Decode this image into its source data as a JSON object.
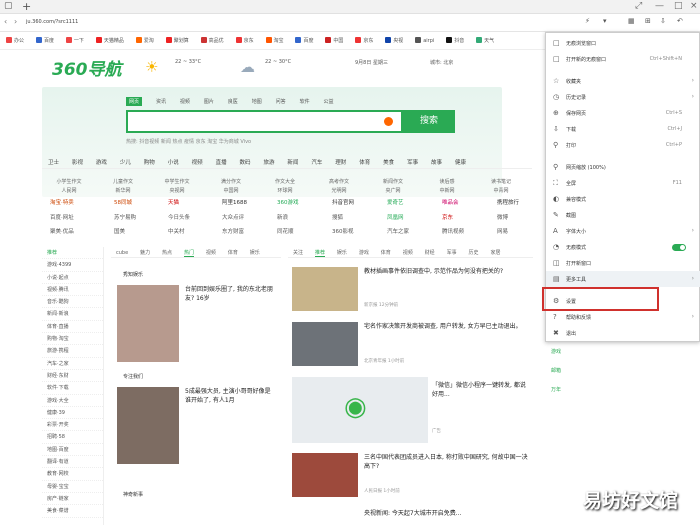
{
  "browser": {
    "url": "ju.360.com/?src1111",
    "bookmarks": [
      "办公",
      "百度",
      "一下",
      "天猫精品",
      "爱淘",
      "聚划算",
      "高品优",
      "京东",
      "淘宝",
      "百度",
      "中国",
      "京东",
      "央视",
      "airpi",
      "抖音",
      "天气",
      "豆瓣"
    ]
  },
  "page": {
    "logo": "360导航",
    "weather": [
      "22 ~ 33°C",
      "22 ~ 30°C",
      "9月8日 星期三",
      "城市: 北京"
    ],
    "search_tabs": [
      "网页",
      "资讯",
      "视频",
      "图片",
      "良医",
      "地图",
      "问答",
      "软件",
      "公益"
    ],
    "search_button": "搜索",
    "hot_words": "热搜: 抖音视频  新闻  热点  疫情  京东  淘宝  华为商城  Vivo",
    "nav": [
      "卫士",
      "影视",
      "游戏",
      "少儿",
      "购物",
      "小说",
      "视频",
      "直播",
      "数码",
      "旅游",
      "新闻",
      "汽车",
      "理财",
      "体育",
      "美食",
      "军事",
      "故事",
      "健康",
      "音乐"
    ],
    "link_row1": [
      "小学生作文",
      "儿童作文",
      "中学生作文",
      "满分作文",
      "作文大全",
      "高考作文",
      "新闻作文",
      "读后感",
      "读书笔记"
    ],
    "link_row2": [
      "人民网",
      "新华网",
      "央视网",
      "中国网",
      "环球网",
      "光明网",
      "央广网",
      "中新网",
      "中青网"
    ],
    "sites": [
      [
        "淘宝·特卖",
        "58同城",
        "天猫",
        "阿里1688",
        "360游戏",
        "抖音官网",
        "爱奇艺",
        "唯品会",
        "携程旅行"
      ],
      [
        "百度·网址",
        "苏宁易购",
        "今日头条",
        "大众点评",
        "新浪",
        "搜狐",
        "凤凰网",
        "京东",
        "微博"
      ],
      [
        "聚美·优品",
        "国美",
        "中关村",
        "东方财富",
        "同花顺",
        "360影视",
        "汽车之家",
        "腾讯视频",
        "网易"
      ]
    ],
    "left_list": [
      "推荐",
      "游戏·4399",
      "小说·起点",
      "视频·腾讯",
      "音乐·酷狗",
      "新闻·新浪",
      "体育·直播",
      "购物·淘宝",
      "旅游·携程",
      "汽车·之家",
      "财经·东财",
      "软件·下载",
      "游戏·大全",
      "健康·39",
      "彩票·开奖",
      "招聘·58",
      "地图·百度",
      "翻译·有道",
      "教育·网校",
      "母婴·宝宝",
      "房产·链家",
      "美食·菜谱"
    ],
    "middle_tabs": [
      "cube",
      "魅力",
      "热点",
      "热门",
      "视频",
      "体育",
      "娱乐",
      "娱乐"
    ],
    "right_tabs": [
      "关注",
      "推荐",
      "娱乐",
      "游戏",
      "体育",
      "视频",
      "财经",
      "军事",
      "历史",
      "家居"
    ],
    "news_mid": [
      {
        "source": "秀知娱乐",
        "title": "台前回到娱乐圈了, 我的东北老朋友? 16岁"
      },
      {
        "source": "专注我们",
        "title": "5成最强大员, 主演小哥哥好像是谁开始了, 有人1月"
      },
      {
        "source": "神奇新事",
        "title": ""
      }
    ],
    "news_right": [
      {
        "title": "教材插画事件依旧调查中, 示范作品为何没有把关的?",
        "meta": "新京报  12分钟前"
      },
      {
        "title": "宅名作家决策开发商被调查, 用户转发, 女方早已主动退出。",
        "meta": "北京青年报  1小时前"
      },
      {
        "title": "「微信」微信小程序一键转发, 都说好用...",
        "meta": "广告"
      },
      {
        "title": "三名中国代表团成员进入日本, 称打败中国研究, 何故中国一决高下?",
        "meta": "人民日报  1小时前"
      },
      {
        "title": "央视新闻: 今天起7大城市开启免费...",
        "meta": "央视新闻"
      }
    ],
    "watermark": "易坊好文馆"
  },
  "menu": {
    "items": [
      {
        "icon": "□",
        "label": "无痕浏览窗口",
        "shortcut": "Ctrl+Shift+N"
      },
      {
        "icon": "□",
        "label": "打开新的无痕窗口",
        "shortcut": "Ctrl+Shift+N"
      },
      {
        "icon": "☆",
        "label": "收藏夹",
        "shortcut": ""
      },
      {
        "icon": "◷",
        "label": "历史记录",
        "shortcut": ""
      },
      {
        "icon": "⊕",
        "label": "保存网页",
        "shortcut": "Ctrl+S"
      },
      {
        "icon": "⇩",
        "label": "下载",
        "shortcut": "Ctrl+J"
      },
      {
        "icon": "⚲",
        "label": "打印",
        "shortcut": "Ctrl+P"
      },
      {
        "icon": "⚲",
        "label": "网页缩放 (100%)",
        "shortcut": ""
      },
      {
        "icon": "⛶",
        "label": "全屏",
        "shortcut": "F11"
      },
      {
        "icon": "◐",
        "label": "兼容模式",
        "shortcut": ""
      },
      {
        "icon": "✎",
        "label": "截图",
        "shortcut": ""
      },
      {
        "icon": "A",
        "label": "字体大小",
        "shortcut": ""
      },
      {
        "icon": "◔",
        "label": "无痕模式",
        "shortcut": ""
      },
      {
        "icon": "◫",
        "label": "打开新窗口",
        "shortcut": ""
      },
      {
        "icon": "▤",
        "label": "更多工具",
        "shortcut": ""
      },
      {
        "icon": "⚙",
        "label": "设置",
        "shortcut": ""
      },
      {
        "icon": "?",
        "label": "帮助和反馈",
        "shortcut": ""
      },
      {
        "icon": "✖",
        "label": "退出",
        "shortcut": ""
      }
    ],
    "rightedge": [
      "游戏",
      "邮箱",
      "万年"
    ]
  }
}
